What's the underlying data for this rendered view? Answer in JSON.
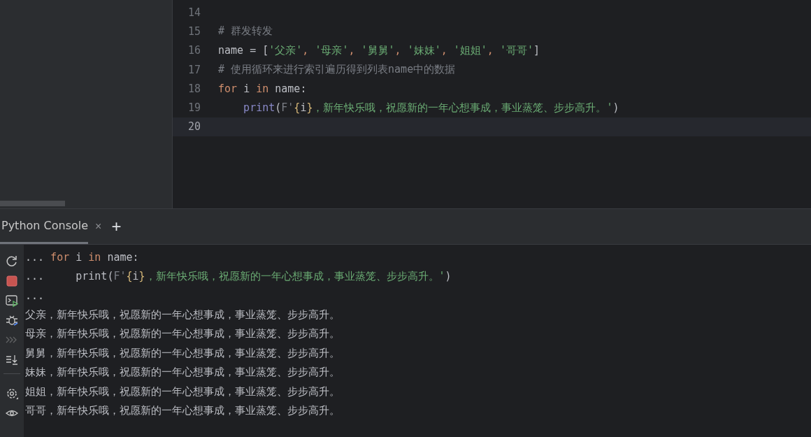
{
  "editor": {
    "lines": [
      {
        "number": "14",
        "current": false
      },
      {
        "number": "15",
        "current": false,
        "tokens": [
          {
            "kind": "comment",
            "text": "# 群发转发"
          }
        ]
      },
      {
        "number": "16",
        "current": false,
        "tokens": [
          {
            "kind": "plain",
            "text": "name = ["
          },
          {
            "kind": "string",
            "text": "'父亲'"
          },
          {
            "kind": "keyword",
            "text": ", "
          },
          {
            "kind": "string",
            "text": "'母亲'"
          },
          {
            "kind": "keyword",
            "text": ", "
          },
          {
            "kind": "string",
            "text": "'舅舅'"
          },
          {
            "kind": "keyword",
            "text": ", "
          },
          {
            "kind": "string",
            "text": "'妹妹'"
          },
          {
            "kind": "keyword",
            "text": ", "
          },
          {
            "kind": "string",
            "text": "'姐姐'"
          },
          {
            "kind": "keyword",
            "text": ", "
          },
          {
            "kind": "string",
            "text": "'哥哥'"
          },
          {
            "kind": "plain",
            "text": "]"
          }
        ]
      },
      {
        "number": "17",
        "current": false,
        "tokens": [
          {
            "kind": "comment",
            "text": "# 使用循环来进行索引遍历得到列表name中的数据"
          }
        ]
      },
      {
        "number": "18",
        "current": false,
        "tokens": [
          {
            "kind": "keyword",
            "text": "for "
          },
          {
            "kind": "plain",
            "text": "i "
          },
          {
            "kind": "keyword",
            "text": "in "
          },
          {
            "kind": "plain",
            "text": "name:"
          }
        ]
      },
      {
        "number": "19",
        "current": false,
        "indented": true,
        "tokens": [
          {
            "kind": "builtin",
            "text": "print"
          },
          {
            "kind": "plain",
            "text": "("
          },
          {
            "kind": "prefix",
            "text": "F'"
          },
          {
            "kind": "interp",
            "text": "{"
          },
          {
            "kind": "plain",
            "text": "i"
          },
          {
            "kind": "interp",
            "text": "}"
          },
          {
            "kind": "string",
            "text": "，新年快乐哦，祝愿新的一年心想事成，事业蒸笼、步步高升。'"
          },
          {
            "kind": "plain",
            "text": ")"
          }
        ]
      },
      {
        "number": "20",
        "current": true
      }
    ]
  },
  "console_tab": {
    "label": "Python Console",
    "close": "×",
    "add": "+",
    "selected": true
  },
  "toolbar": [
    {
      "kind": "rerun"
    },
    {
      "kind": "stop"
    },
    {
      "kind": "console"
    },
    {
      "kind": "debug"
    },
    {
      "kind": "history",
      "disabled": true
    },
    {
      "kind": "scroll-end"
    },
    {
      "kind": "divider"
    },
    {
      "kind": "settings"
    },
    {
      "kind": "view"
    }
  ],
  "console": [
    {
      "prompt": "...",
      "tokens": [
        {
          "kind": "keyword",
          "text": "for "
        },
        {
          "kind": "plain",
          "text": "i "
        },
        {
          "kind": "keyword",
          "text": "in "
        },
        {
          "kind": "plain",
          "text": "name:"
        }
      ]
    },
    {
      "prompt": "...",
      "indented": true,
      "tokens": [
        {
          "kind": "plain",
          "text": "print("
        },
        {
          "kind": "prefix",
          "text": "F'"
        },
        {
          "kind": "interp",
          "text": "{"
        },
        {
          "kind": "plain",
          "text": "i"
        },
        {
          "kind": "interp",
          "text": "}"
        },
        {
          "kind": "string",
          "text": "，新年快乐哦，祝愿新的一年心想事成，事业蒸笼、步步高升。'"
        },
        {
          "kind": "plain",
          "text": ")"
        }
      ]
    },
    {
      "prompt": "..."
    },
    {
      "output": "父亲，新年快乐哦，祝愿新的一年心想事成，事业蒸笼、步步高升。"
    },
    {
      "output": "母亲，新年快乐哦，祝愿新的一年心想事成，事业蒸笼、步步高升。"
    },
    {
      "output": "舅舅，新年快乐哦，祝愿新的一年心想事成，事业蒸笼、步步高升。"
    },
    {
      "output": "妹妹，新年快乐哦，祝愿新的一年心想事成，事业蒸笼、步步高升。"
    },
    {
      "output": "姐姐，新年快乐哦，祝愿新的一年心想事成，事业蒸笼、步步高升。"
    },
    {
      "output": "哥哥，新年快乐哦，祝愿新的一年心想事成，事业蒸笼、步步高升。"
    }
  ]
}
